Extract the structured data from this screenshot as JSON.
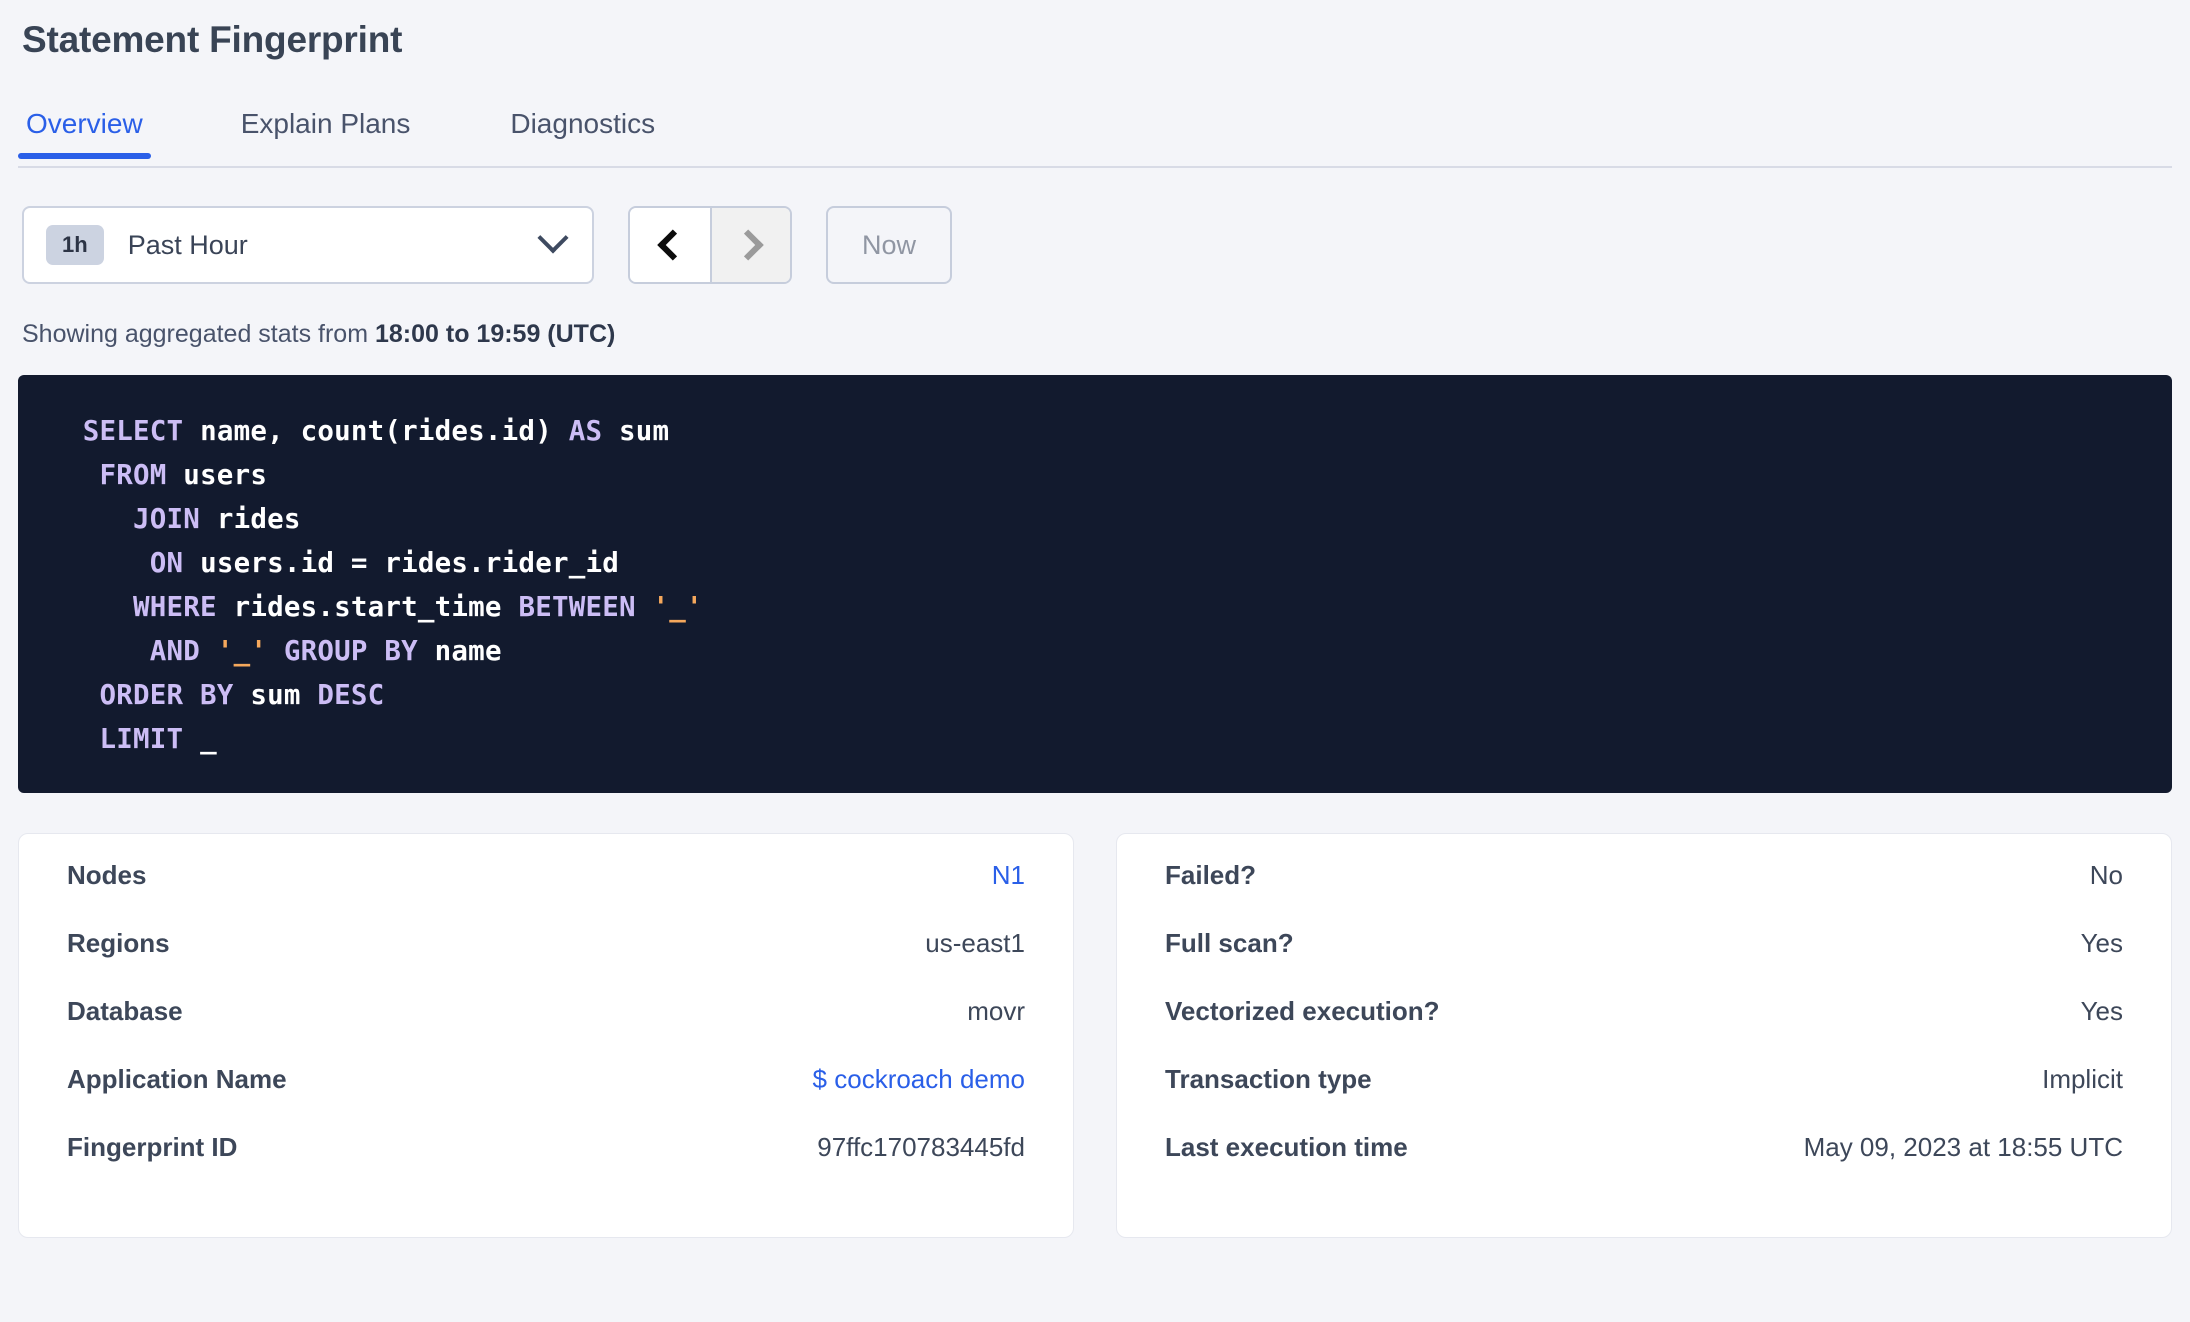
{
  "header": {
    "title": "Statement Fingerprint"
  },
  "tabs": [
    {
      "label": "Overview",
      "active": true
    },
    {
      "label": "Explain Plans",
      "active": false
    },
    {
      "label": "Diagnostics",
      "active": false
    }
  ],
  "time_controls": {
    "range_badge": "1h",
    "range_label": "Past Hour",
    "prev_label": "‹",
    "next_label": "›",
    "now_label": "Now"
  },
  "showing": {
    "prefix": "Showing aggregated stats from ",
    "range": "18:00 to 19:59 (UTC)"
  },
  "sql": {
    "lines": [
      [
        {
          "t": "kw",
          "v": " SELECT "
        },
        {
          "t": "id",
          "v": "name, count(rides.id) "
        },
        {
          "t": "kw",
          "v": "AS "
        },
        {
          "t": "id",
          "v": "sum"
        }
      ],
      [
        {
          "t": "kw",
          "v": "  FROM "
        },
        {
          "t": "id",
          "v": "users"
        }
      ],
      [
        {
          "t": "kw",
          "v": "    JOIN "
        },
        {
          "t": "id",
          "v": "rides"
        }
      ],
      [
        {
          "t": "kw",
          "v": "     ON "
        },
        {
          "t": "id",
          "v": "users.id = rides.rider_id"
        }
      ],
      [
        {
          "t": "kw",
          "v": "    WHERE "
        },
        {
          "t": "id",
          "v": "rides.start_time "
        },
        {
          "t": "kw",
          "v": "BETWEEN "
        },
        {
          "t": "str",
          "v": "'_'"
        }
      ],
      [
        {
          "t": "kw",
          "v": "     AND "
        },
        {
          "t": "str",
          "v": "'_'"
        },
        {
          "t": "kw",
          "v": " GROUP BY "
        },
        {
          "t": "id",
          "v": "name"
        }
      ],
      [
        {
          "t": "kw",
          "v": "  ORDER BY "
        },
        {
          "t": "id",
          "v": "sum "
        },
        {
          "t": "kw",
          "v": "DESC"
        }
      ],
      [
        {
          "t": "kw",
          "v": "  LIMIT "
        },
        {
          "t": "id",
          "v": "_"
        }
      ]
    ]
  },
  "left_card": {
    "rows": [
      {
        "label": "Nodes",
        "value": "N1",
        "link": true
      },
      {
        "label": "Regions",
        "value": "us-east1",
        "link": false
      },
      {
        "label": "Database",
        "value": "movr",
        "link": false
      },
      {
        "label": "Application Name",
        "value": "$ cockroach demo",
        "link": true
      },
      {
        "label": "Fingerprint ID",
        "value": "97ffc170783445fd",
        "link": false
      }
    ]
  },
  "right_card": {
    "rows": [
      {
        "label": "Failed?",
        "value": "No",
        "link": false
      },
      {
        "label": "Full scan?",
        "value": "Yes",
        "link": false
      },
      {
        "label": "Vectorized execution?",
        "value": "Yes",
        "link": false
      },
      {
        "label": "Transaction type",
        "value": "Implicit",
        "link": false
      },
      {
        "label": "Last execution time",
        "value": "May 09, 2023 at 18:55 UTC",
        "link": false
      }
    ]
  },
  "colors": {
    "accent": "#2a5fe8",
    "page_bg": "#f4f5f9",
    "code_bg": "#121a2e",
    "keyword": "#ccbdf5",
    "string": "#f5a85c",
    "text": "#3d4759"
  }
}
